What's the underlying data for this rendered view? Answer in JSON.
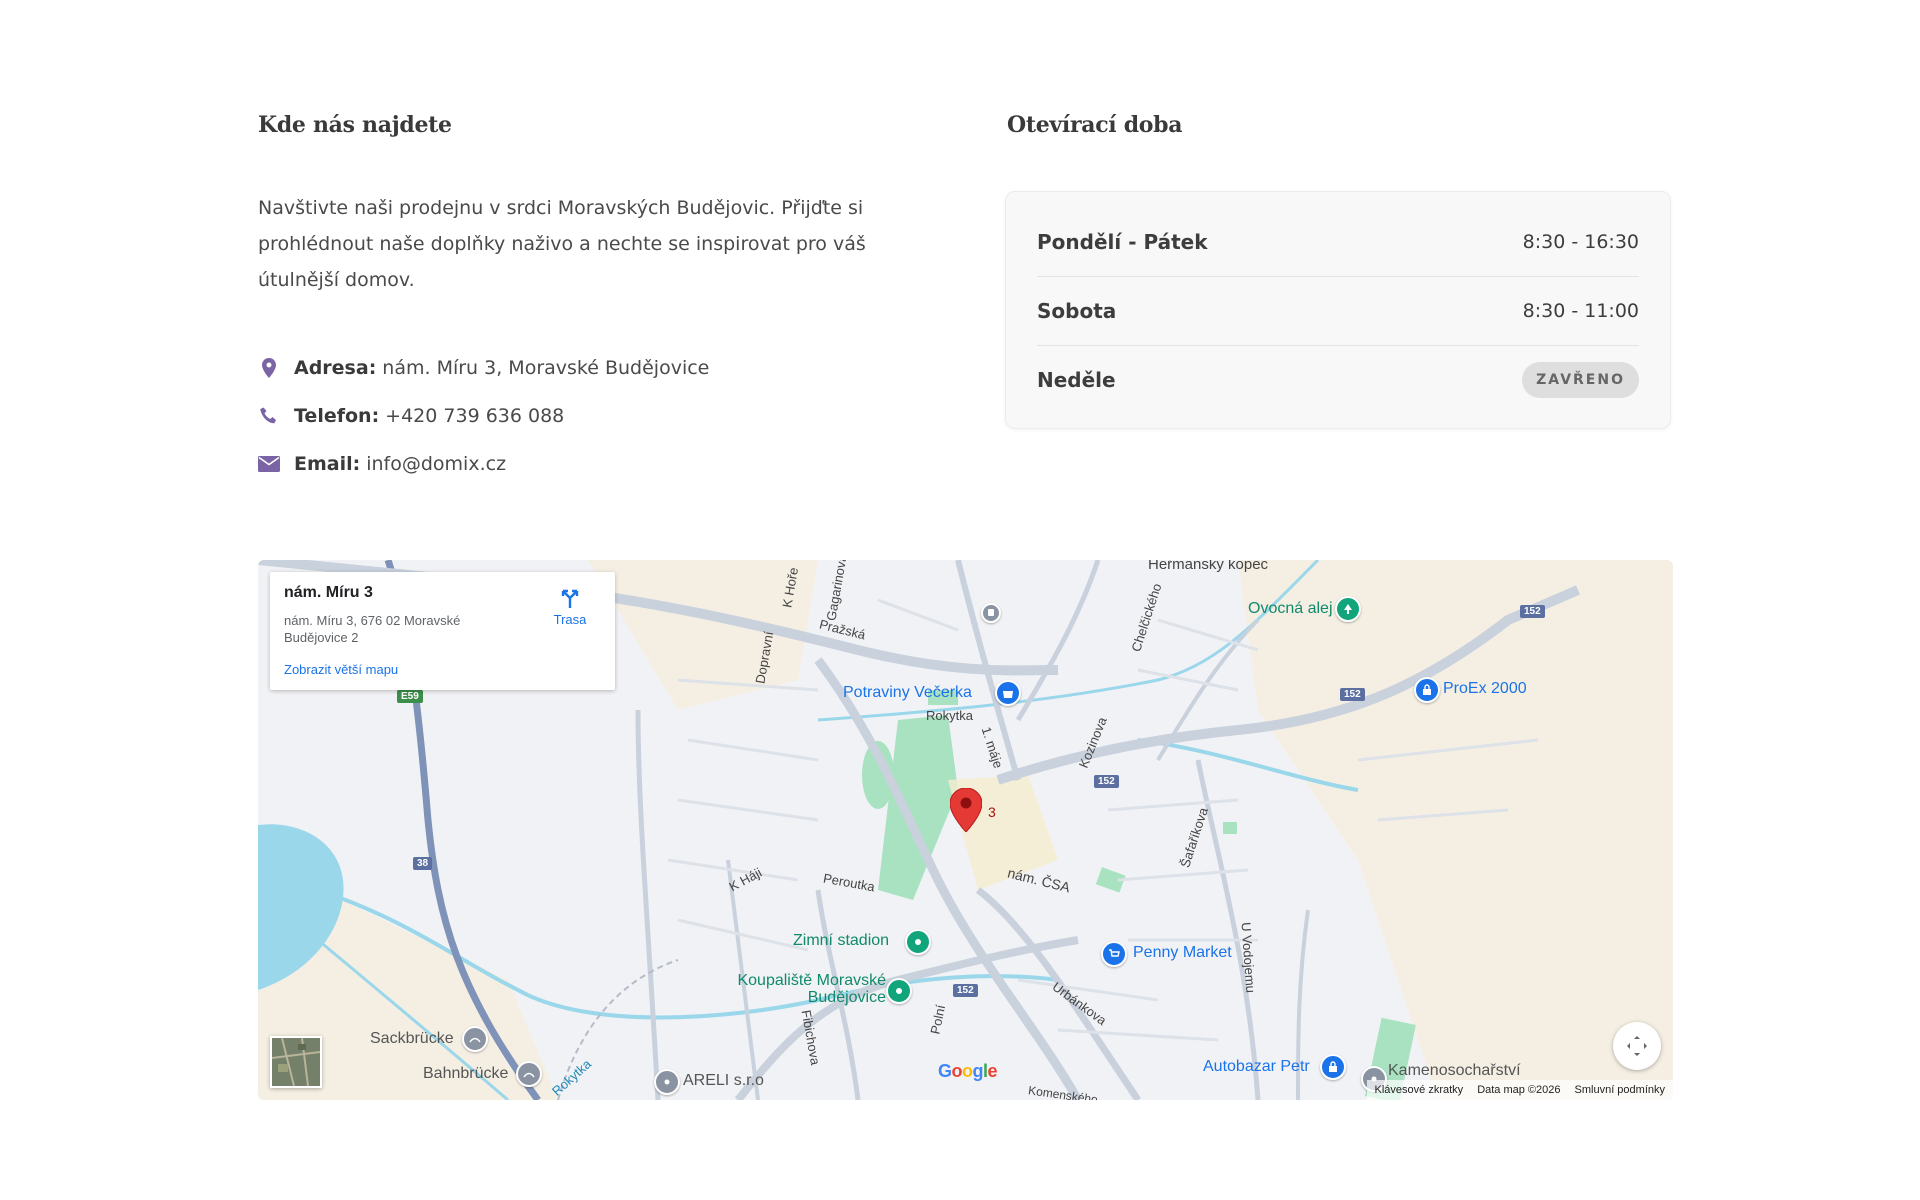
{
  "location": {
    "heading": "Kde nás najdete",
    "intro": "Navštivte naši prodejnu v srdci Moravských Budějovic. Přijďte si prohlédnout naše doplňky naživo a nechte se inspirovat pro váš útulnější domov.",
    "contacts": [
      {
        "icon": "map-marker-icon",
        "label": "Adresa:",
        "value": "nám. Míru 3, Moravské Budějovice"
      },
      {
        "icon": "phone-icon",
        "label": "Telefon:",
        "value": "+420 739 636 088"
      },
      {
        "icon": "envelope-icon",
        "label": "Email:",
        "value": "info@domix.cz"
      }
    ]
  },
  "hours": {
    "heading": "Otevírací doba",
    "rows": [
      {
        "day": "Pondělí - Pátek",
        "time": "8:30 - 16:30"
      },
      {
        "day": "Sobota",
        "time": "8:30 - 11:00"
      },
      {
        "day": "Neděle",
        "badge": "ZAVŘENO"
      }
    ]
  },
  "map": {
    "info_card": {
      "title": "nám. Míru 3",
      "address": "nám. Míru 3, 676 02 Moravské Budějovice 2",
      "link": "Zobrazit větší mapu",
      "directions": "Trasa"
    },
    "marker_label": "3",
    "pois": {
      "potraviny": "Potraviny Večerka",
      "ovocna": "Ovocná alej",
      "proex": "ProEx 2000",
      "zimni": "Zimní stadion",
      "koupaliste": "Koupaliště Moravské Budějovice",
      "penny": "Penny Market",
      "autobazar": "Autobazar Petr",
      "kameno": "Kamenosochařství",
      "areli": "ARELI s.r.o",
      "sackbrucke": "Sackbrücke",
      "bahnbrucke": "Bahnbrücke",
      "hermansky": "Heřmanský kopec"
    },
    "streets": {
      "prazska": "Pražská",
      "dopravni": "Dopravní",
      "kHore": "K Hoře",
      "gagarinova": "Gagarinova",
      "chelcickeho": "Chelčického",
      "rokytka1": "Rokytka",
      "rokytka2": "Rokytka",
      "maje": "1. máje",
      "kozinova": "Kozinova",
      "safarikova": "Šafaříkova",
      "namCsa": "nám. ČSA",
      "kHaji": "K Háji",
      "peroutka": "Peroutka",
      "fibichova": "Fibichova",
      "polni": "Polní",
      "urbankova": "Urbánkova",
      "uVodojemu": "U Vodojemu",
      "komenskeho": "Komenského"
    },
    "shields": {
      "e59": "E59",
      "r38": "38",
      "r152a": "152",
      "r152b": "152",
      "r152c": "152",
      "r152d": "152"
    },
    "google": "Google",
    "attribution": {
      "shortcuts": "Klávesové zkratky",
      "data": "Data map ©2026",
      "terms": "Smluvní podmínky"
    },
    "colors": {
      "water": "#9ad7eb",
      "park": "#a8e2c0",
      "road": "#c9d1dd",
      "marker": "#e53935"
    }
  }
}
